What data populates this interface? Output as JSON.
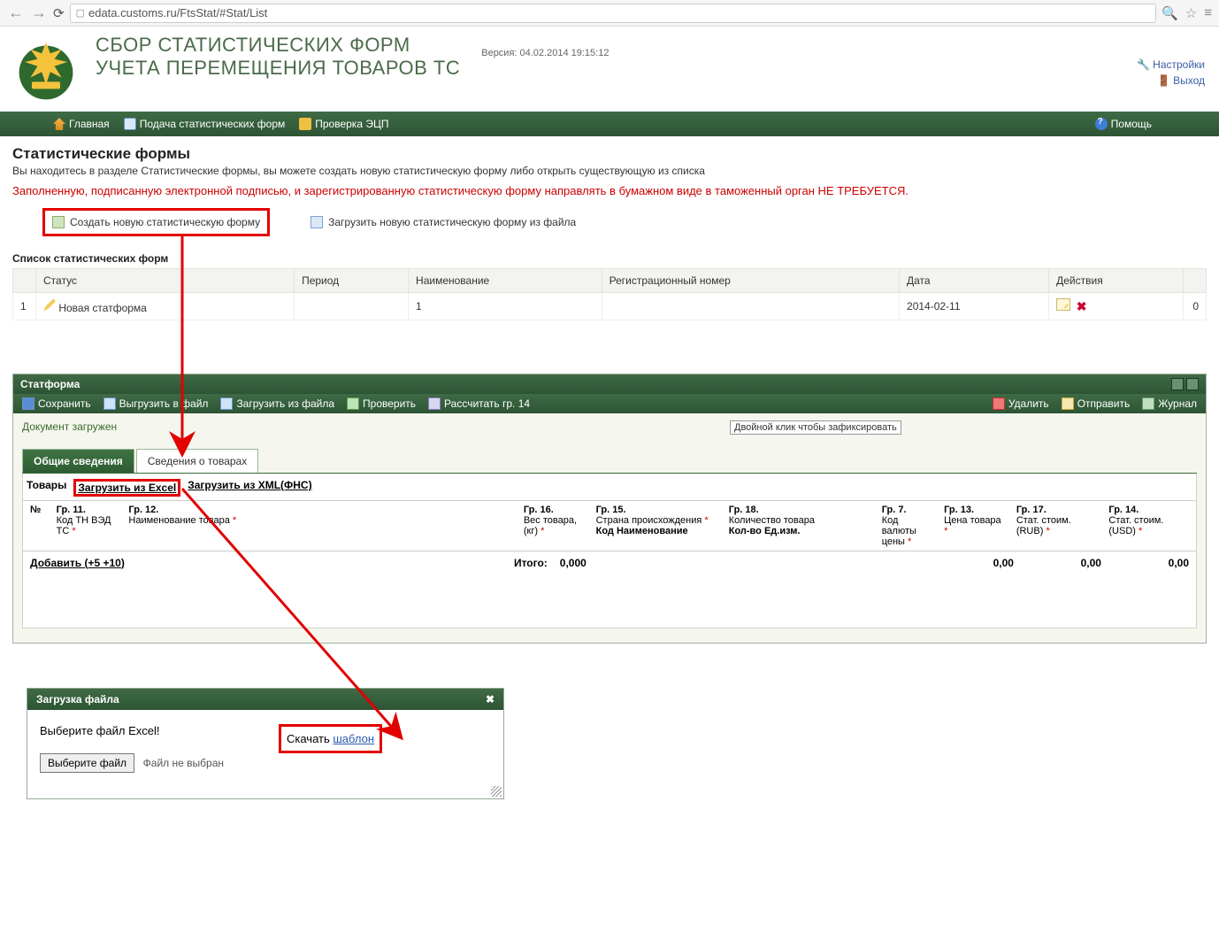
{
  "browser": {
    "url": "edata.customs.ru/FtsStat/#Stat/List"
  },
  "header": {
    "title1": "СБОР СТАТИСТИЧЕСКИХ ФОРМ",
    "title2": "УЧЕТА ПЕРЕМЕЩЕНИЯ ТОВАРОВ ТС",
    "version": "Версия: 04.02.2014 19:15:12",
    "settings": "Настройки",
    "exit": "Выход"
  },
  "nav": {
    "home": "Главная",
    "submit": "Подача статистических форм",
    "check": "Проверка ЭЦП",
    "help": "Помощь"
  },
  "page": {
    "h1": "Статистические формы",
    "sub": "Вы находитесь в разделе Статистические формы, вы можете создать новую статистическую форму либо открыть существующую из списка",
    "red": "Заполненную, подписанную электронной подписью, и зарегистрированную статистическую форму направлять в бумажном виде в таможенный орган НЕ ТРЕБУЕТСЯ.",
    "create": "Создать новую статистическую форму",
    "upload": "Загрузить новую статистическую форму из файла",
    "listTitle": "Список статистических форм"
  },
  "table": {
    "cols": {
      "status": "Статус",
      "period": "Период",
      "name": "Наименование",
      "reg": "Регистрационный номер",
      "date": "Дата",
      "actions": "Действия"
    },
    "row": {
      "n": "1",
      "status": "Новая статформа",
      "period": "",
      "name": "1",
      "reg": "",
      "date": "2014-02-11",
      "tail": "0"
    }
  },
  "panel": {
    "title": "Статформа",
    "toolbar": {
      "save": "Сохранить",
      "exportFile": "Выгрузить в файл",
      "importFile": "Загрузить из файла",
      "check": "Проверить",
      "calc": "Рассчитать гр. 14",
      "delete": "Удалить",
      "send": "Отправить",
      "journal": "Журнал"
    },
    "status": "Документ загружен",
    "tooltip": "Двойной клик чтобы зафиксировать",
    "tabs": {
      "general": "Общие сведения",
      "goods": "Сведения о товарах"
    },
    "sub": {
      "label": "Товары",
      "excel": "Загрузить из Excel",
      "xml": "Загрузить из XML(ФНС)"
    },
    "cols": {
      "n": "№",
      "g11": "Гр. 11.",
      "g11b": "Код ТН ВЭД ТС",
      "g12": "Гр. 12.",
      "g12b": "Наименование товара",
      "g16": "Гр. 16.",
      "g16b": "Вес товара, (кг)",
      "g15": "Гр. 15.",
      "g15b": "Страна происхождения",
      "g15c": "Код",
      "g15d": "Наименование",
      "g18": "Гр. 18.",
      "g18b": "Количество товара",
      "g18c": "Кол-во",
      "g18d": "Ед.изм.",
      "g7": "Гр. 7.",
      "g7b": "Код валюты цены",
      "g13": "Гр. 13.",
      "g13b": "Цена товара",
      "g17": "Гр. 17.",
      "g17b": "Стат. стоим. (RUB)",
      "g14": "Гр. 14.",
      "g14b": "Стат. стоим. (USD)"
    },
    "add": {
      "label": "Добавить",
      "p5": "+5",
      "p10": "+10"
    },
    "totals": {
      "label": "Итого:",
      "weight": "0,000",
      "price": "0,00",
      "rub": "0,00",
      "usd": "0,00"
    }
  },
  "dialog": {
    "title": "Загрузка файла",
    "prompt": "Выберите файл Excel!",
    "download": "Скачать",
    "template": "шаблон",
    "choose": "Выберите файл",
    "nofile": "Файл не выбран"
  }
}
